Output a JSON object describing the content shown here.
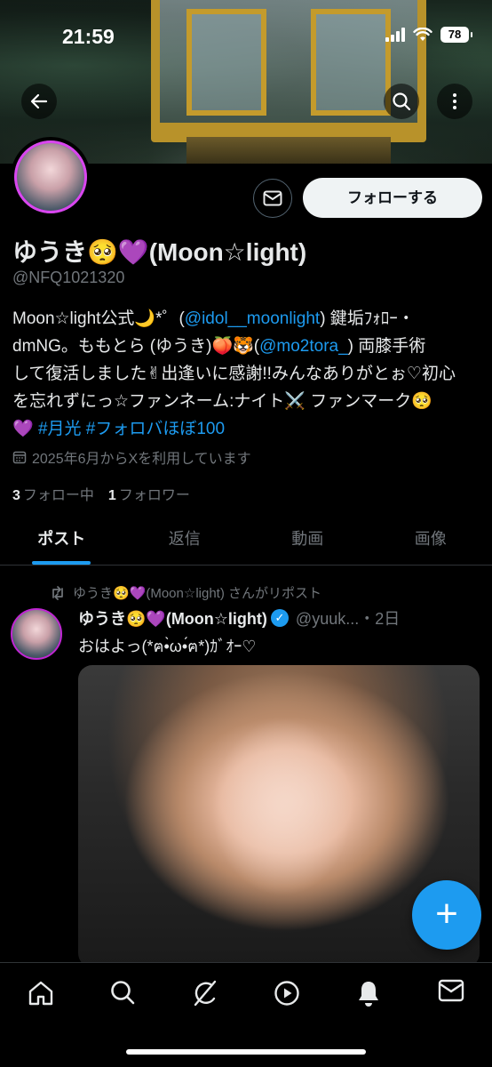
{
  "status_bar": {
    "time": "21:59",
    "battery": "78"
  },
  "profile": {
    "follow_label": "フォローする",
    "name": "ゆうき🥺💜(Moon☆light)",
    "handle": "@NFQ1021320",
    "bio": {
      "line1_a": "Moon☆light公式🌙*゜(",
      "line1_link": "@idol__moonlight",
      "line1_b": ") 鍵垢ﾌｫﾛｰ・",
      "line2_a": "dmNG。ももとら (ゆうき)🍑🐯(",
      "line2_link": "@mo2tora_",
      "line2_b": ") 両膝手術",
      "line3": "して復活しました✌︎出逢いに感謝!!みんなありがとぉ♡初心",
      "line4": "を忘れずにっ☆ファンネーム:ナイト⚔️ ファンマーク🥺",
      "line5_a": "💜 ",
      "hashtags": "#月光 #フォロバほぼ100"
    },
    "joined": "2025年6月からXを利用しています",
    "following_count": "3",
    "following_label": "フォロー中",
    "followers_count": "1",
    "followers_label": "フォロワー"
  },
  "tabs": [
    {
      "label": "ポスト",
      "active": true
    },
    {
      "label": "返信"
    },
    {
      "label": "動画"
    },
    {
      "label": "画像"
    }
  ],
  "post": {
    "repost_text": "ゆうき🥺💜(Moon☆light) さんがリポスト",
    "author_name": "ゆうき🥺💜(Moon☆light)",
    "author_meta": "@yuuk...・2日",
    "text": "おはよっ(*ฅ•̀ω•́ฅ*)ｶﾞｵｰ♡"
  },
  "icons": {
    "back": "arrow-left-icon",
    "search": "search-icon",
    "more": "more-vertical-icon",
    "message": "envelope-icon",
    "calendar": "calendar-icon",
    "repost": "repost-icon",
    "verified": "verified-badge-icon",
    "compose": "plus-icon",
    "nav": [
      "home-icon",
      "search-icon",
      "grok-icon",
      "play-circle-icon",
      "bell-icon",
      "envelope-icon"
    ]
  },
  "colors": {
    "accent": "#1d9bf0",
    "background": "#000000",
    "muted": "#71767b",
    "text": "#e7e9ea"
  }
}
